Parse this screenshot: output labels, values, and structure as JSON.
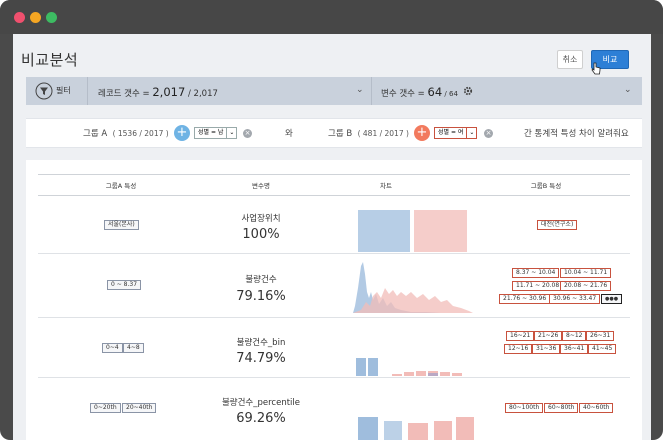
{
  "window": {
    "controls": [
      {
        "name": "close",
        "color": "#f0506e"
      },
      {
        "name": "minimize",
        "color": "#f5a623"
      },
      {
        "name": "maximize",
        "color": "#3dbb62"
      }
    ]
  },
  "page": {
    "title": "비교분석",
    "cancel_label": "취소",
    "compare_label": "비교"
  },
  "filter": {
    "label": "필터",
    "record_prefix": "레코드 갯수 = ",
    "record_selected": "2,017",
    "record_total": " / 2,017",
    "var_prefix": "변수 갯수 = ",
    "var_selected": "64",
    "var_total": " / 64"
  },
  "groups": {
    "a_label": "그룹 A",
    "a_count": "( 1536 / 2017 )",
    "a_condition": "성별 = 남",
    "connector": "와",
    "b_label": "그룹 B",
    "b_count": "( 481 / 2017 )",
    "b_condition": "성별 = 여",
    "question": "간 통계적 특성 차이 알려줘요"
  },
  "table": {
    "headers": [
      "그룹A 특성",
      "변수명",
      "차트",
      "그룹B 특성"
    ],
    "rows": [
      {
        "variable": "사업장위치",
        "percent": "100%",
        "group_a_tags": [
          "서울(본사)"
        ],
        "group_b_tags": [
          "대전(연구소)"
        ]
      },
      {
        "variable": "불량건수",
        "percent": "79.16%",
        "group_a_tags": [
          "0 ~ 8.37"
        ],
        "group_b_tags": [
          "8.37 ~ 10.04",
          "10.04 ~ 11.71",
          "11.71 ~ 20.08",
          "20.08 ~ 21.76",
          "21.76 ~ 30.96",
          "30.96 ~ 33.47",
          "●●●"
        ]
      },
      {
        "variable": "불량건수_bin",
        "percent": "74.79%",
        "group_a_tags": [
          "0~4",
          "4~8"
        ],
        "group_b_tags": [
          "16~21",
          "21~26",
          "8~12",
          "26~31",
          "12~16",
          "31~36",
          "36~41",
          "41~45"
        ]
      },
      {
        "variable": "불량건수_percentile",
        "percent": "69.26%",
        "group_a_tags": [
          "0~20th",
          "20~40th"
        ],
        "group_b_tags": [
          "80~100th",
          "60~80th",
          "40~60th"
        ]
      }
    ]
  },
  "colors": {
    "group_a": "#9fbddd",
    "group_b": "#f2bcb8",
    "accent": "#2d7fd6"
  }
}
